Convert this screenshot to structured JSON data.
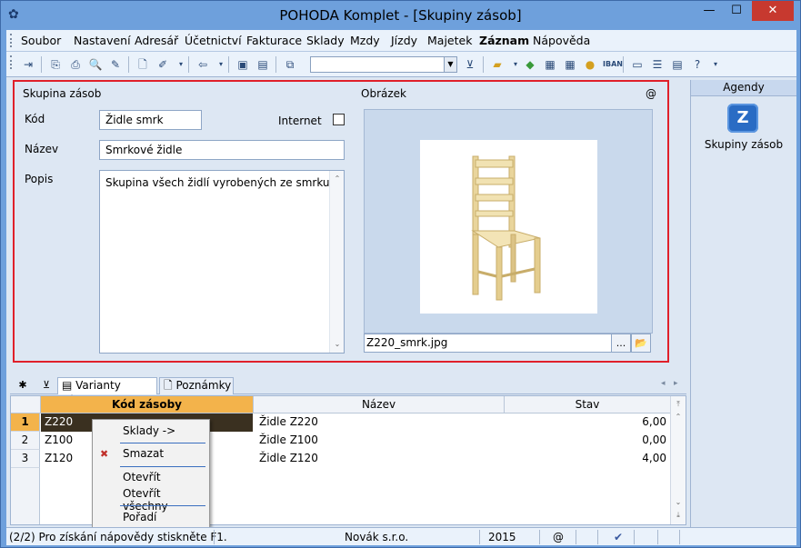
{
  "window": {
    "title": "POHODA Komplet - [Skupiny zásob]"
  },
  "menu": [
    "Soubor",
    "Nastavení",
    "Adresář",
    "Účetnictví",
    "Fakturace",
    "Sklady",
    "Mzdy",
    "Jízdy",
    "Majetek",
    "Záznam",
    "Nápověda"
  ],
  "form": {
    "section_label": "Skupina zásob",
    "kod_label": "Kód",
    "kod_value": "Židle smrk",
    "internet_label": "Internet",
    "nazev_label": "Název",
    "nazev_value": "Smrkové židle",
    "popis_label": "Popis",
    "popis_value": "Skupina všech židlí vyrobených ze smrku",
    "obrazek_label": "Obrázek",
    "at_sign": "@",
    "image_file": "Z220_smrk.jpg",
    "browse_label": "...",
    "open_label": "📂"
  },
  "agendy": {
    "header": "Agendy",
    "item_label": "Skupiny zásob",
    "item_icon": "Z"
  },
  "tabs": {
    "star": "✱",
    "filter": "⊻",
    "varianty": "Varianty zásoby",
    "poznamky": "Poznámky"
  },
  "grid": {
    "columns": [
      "Kód zásoby",
      "Název",
      "Stav"
    ],
    "rows": [
      {
        "num": "1",
        "kod": "Z220",
        "nazev": "Židle Z220",
        "stav": "6,00"
      },
      {
        "num": "2",
        "kod": "Z100",
        "nazev": "Židle Z100",
        "stav": "0,00"
      },
      {
        "num": "3",
        "kod": "Z120",
        "nazev": "Židle Z120",
        "stav": "4,00"
      }
    ]
  },
  "context_menu": {
    "sklady": "Sklady ->",
    "smazat": "Smazat",
    "otevrit": "Otevřít",
    "otevrit_vse": "Otevřít všechny",
    "poradi": "Pořadí"
  },
  "status": {
    "message": "(2/2) Pro získání nápovědy stiskněte F1.",
    "company": "Novák s.r.o.",
    "year": "2015",
    "at": "@"
  }
}
